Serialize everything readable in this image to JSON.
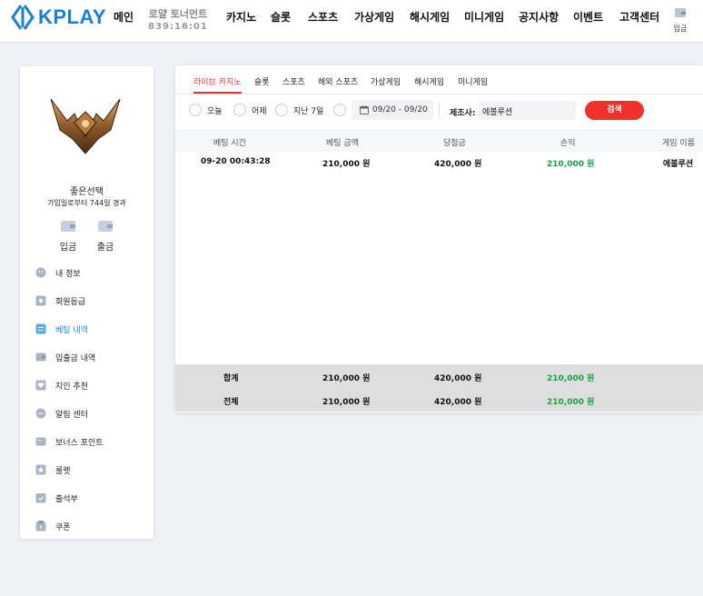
{
  "header": {
    "logo_text": "KPLAY",
    "nav": [
      {
        "label": "메인"
      },
      {
        "label": "카지노"
      },
      {
        "label": "슬롯"
      },
      {
        "label": "스포츠"
      },
      {
        "label": "가상게임"
      },
      {
        "label": "해시게임"
      },
      {
        "label": "미니게임"
      },
      {
        "label": "공지사항"
      },
      {
        "label": "이벤트"
      },
      {
        "label": "고객센터"
      }
    ],
    "tournament": {
      "label": "로얄 토너먼트",
      "count": "839:16:01"
    },
    "deposit_label": "입금"
  },
  "sidebar": {
    "username": "좋은선택",
    "joined": "가입일로부터 744일 경과",
    "deposit_label": "입금",
    "withdraw_label": "출금",
    "menu": [
      {
        "label": "내 정보",
        "icon": "face-icon"
      },
      {
        "label": "회원등급",
        "icon": "medal-icon"
      },
      {
        "label": "베팅 내역",
        "icon": "list-icon"
      },
      {
        "label": "입출금 내역",
        "icon": "wallet-icon"
      },
      {
        "label": "지인 추천",
        "icon": "heart-icon"
      },
      {
        "label": "알림 센터",
        "icon": "chat-icon"
      },
      {
        "label": "보너스 포인트",
        "icon": "point-icon"
      },
      {
        "label": "룰렛",
        "icon": "roulette-icon"
      },
      {
        "label": "출석부",
        "icon": "calendar-check-icon"
      },
      {
        "label": "쿠폰",
        "icon": "coupon-icon"
      }
    ],
    "active_index": 2
  },
  "tabs": [
    {
      "label": "라이브 카지노"
    },
    {
      "label": "슬롯"
    },
    {
      "label": "스포츠"
    },
    {
      "label": "해외 스포츠"
    },
    {
      "label": "가상게임"
    },
    {
      "label": "해시게임"
    },
    {
      "label": "미니게임"
    }
  ],
  "active_tab": 0,
  "filters": {
    "today": "오늘",
    "yesterday": "어제",
    "last7": "지난 7일",
    "date_range": "09/20 - 09/20",
    "maker_label": "제조사:",
    "maker_value": "에볼루션",
    "search_label": "검색"
  },
  "table": {
    "headers": [
      "베팅 시간",
      "베팅 금액",
      "당첨금",
      "손익",
      "게임 이름"
    ],
    "rows": [
      {
        "time": "09-20 00:43:28",
        "bet": "210,000 원",
        "win": "420,000 원",
        "profit": "210,000 원",
        "game": "에볼루션"
      }
    ],
    "subtotal": {
      "label": "합계",
      "bet": "210,000 원",
      "win": "420,000 원",
      "profit": "210,000 원"
    },
    "total": {
      "label": "전체",
      "bet": "210,000 원",
      "win": "420,000 원",
      "profit": "210,000 원"
    }
  },
  "colors": {
    "accent_blue": "#1a7fd6",
    "accent_red": "#f0302c",
    "profit_green": "#17a447"
  }
}
